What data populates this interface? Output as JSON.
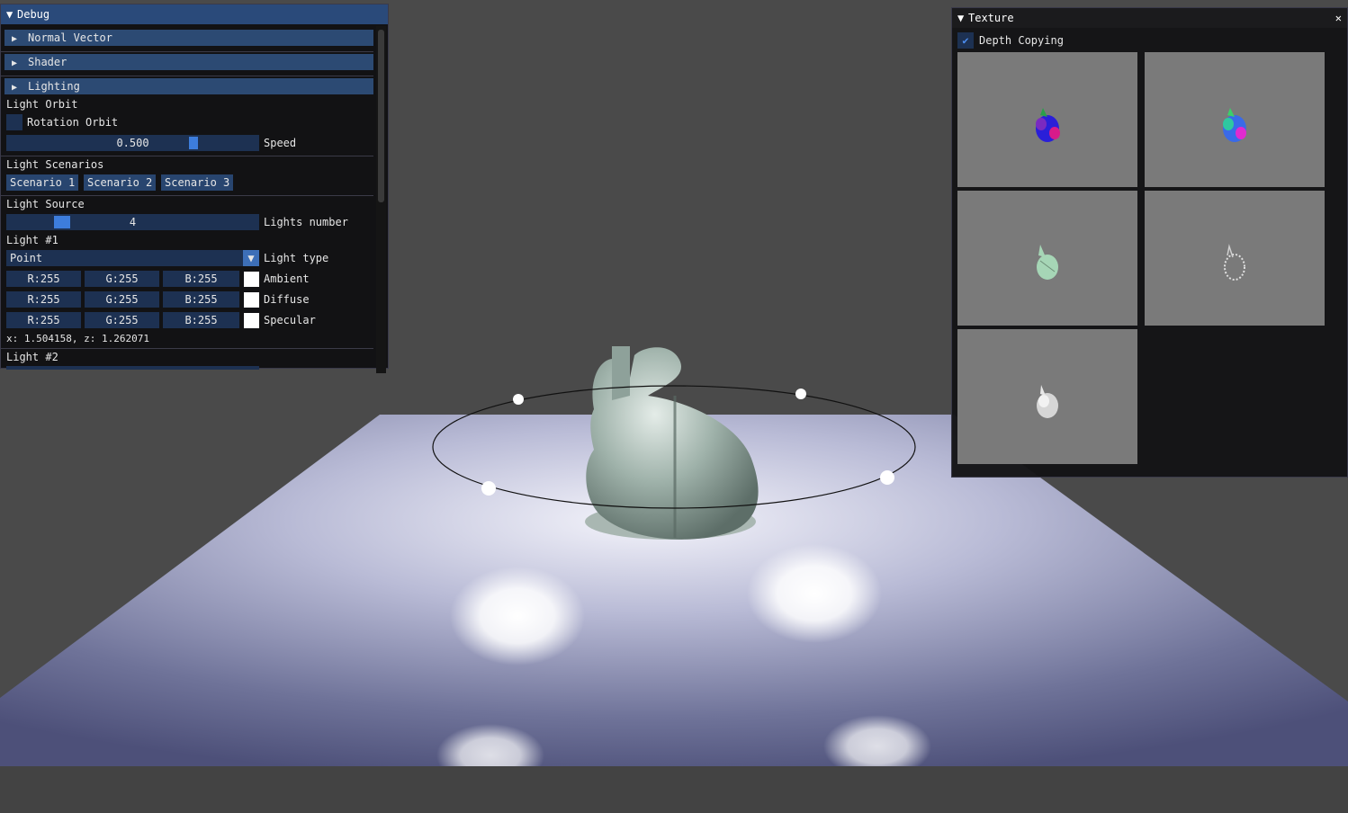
{
  "debug": {
    "title": "Debug",
    "sections": {
      "normal_vector": "Normal Vector",
      "shader": "Shader",
      "lighting": "Lighting"
    },
    "light_orbit": {
      "heading": "Light Orbit",
      "rotation_label": "Rotation Orbit",
      "rotation_checked": false,
      "speed_value": "0.500",
      "speed_fraction": 0.5,
      "speed_label": "Speed"
    },
    "light_scenarios": {
      "heading": "Light Scenarios",
      "buttons": [
        "Scenario 1",
        "Scenario 2",
        "Scenario 3"
      ]
    },
    "light_source": {
      "heading": "Light Source",
      "count_value": "4",
      "count_label": "Lights number"
    },
    "light1": {
      "heading": "Light #1",
      "type_value": "Point",
      "type_label": "Light type",
      "ambient": {
        "r": "R:255",
        "g": "G:255",
        "b": "B:255",
        "label": "Ambient",
        "color": "#ffffff"
      },
      "diffuse": {
        "r": "R:255",
        "g": "G:255",
        "b": "B:255",
        "label": "Diffuse",
        "color": "#ffffff"
      },
      "specular": {
        "r": "R:255",
        "g": "G:255",
        "b": "B:255",
        "label": "Specular",
        "color": "#ffffff"
      },
      "position": "x: 1.504158, z: 1.262071"
    },
    "light2": {
      "heading": "Light #2"
    }
  },
  "texture": {
    "title": "Texture",
    "close_icon": "close-icon",
    "depth_copying_label": "Depth Copying",
    "depth_copying_checked": true,
    "tiles": [
      "normal-buffer",
      "position-buffer",
      "albedo-buffer",
      "specular-buffer",
      "depth-buffer"
    ]
  },
  "colors": {
    "title_bar": "#2a4a7a",
    "header": "#2c4a73",
    "frame": "#1d3152",
    "accent": "#3d7ddc",
    "floor": "#7a7fa6"
  }
}
